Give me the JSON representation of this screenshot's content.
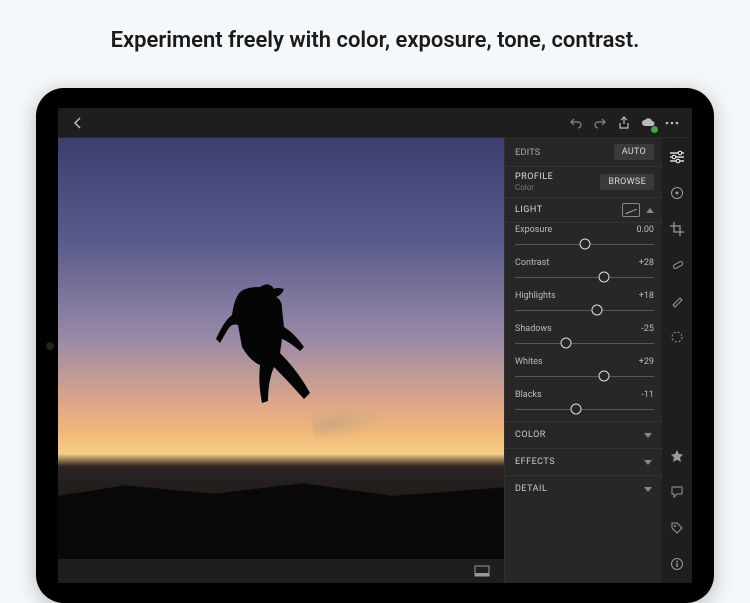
{
  "headline": "Experiment freely with color, exposure, tone, contrast.",
  "panel": {
    "edits_label": "EDITS",
    "auto_label": "AUTO",
    "profile_label": "PROFILE",
    "profile_value": "Color",
    "browse_label": "BROWSE",
    "light_label": "LIGHT",
    "color_label": "COLOR",
    "effects_label": "EFFECTS",
    "detail_label": "DETAIL"
  },
  "sliders": [
    {
      "label": "Exposure",
      "value": "0.00",
      "pos": 50
    },
    {
      "label": "Contrast",
      "value": "+28",
      "pos": 64
    },
    {
      "label": "Highlights",
      "value": "+18",
      "pos": 59
    },
    {
      "label": "Shadows",
      "value": "-25",
      "pos": 37
    },
    {
      "label": "Whites",
      "value": "+29",
      "pos": 64
    },
    {
      "label": "Blacks",
      "value": "-11",
      "pos": 44
    }
  ]
}
